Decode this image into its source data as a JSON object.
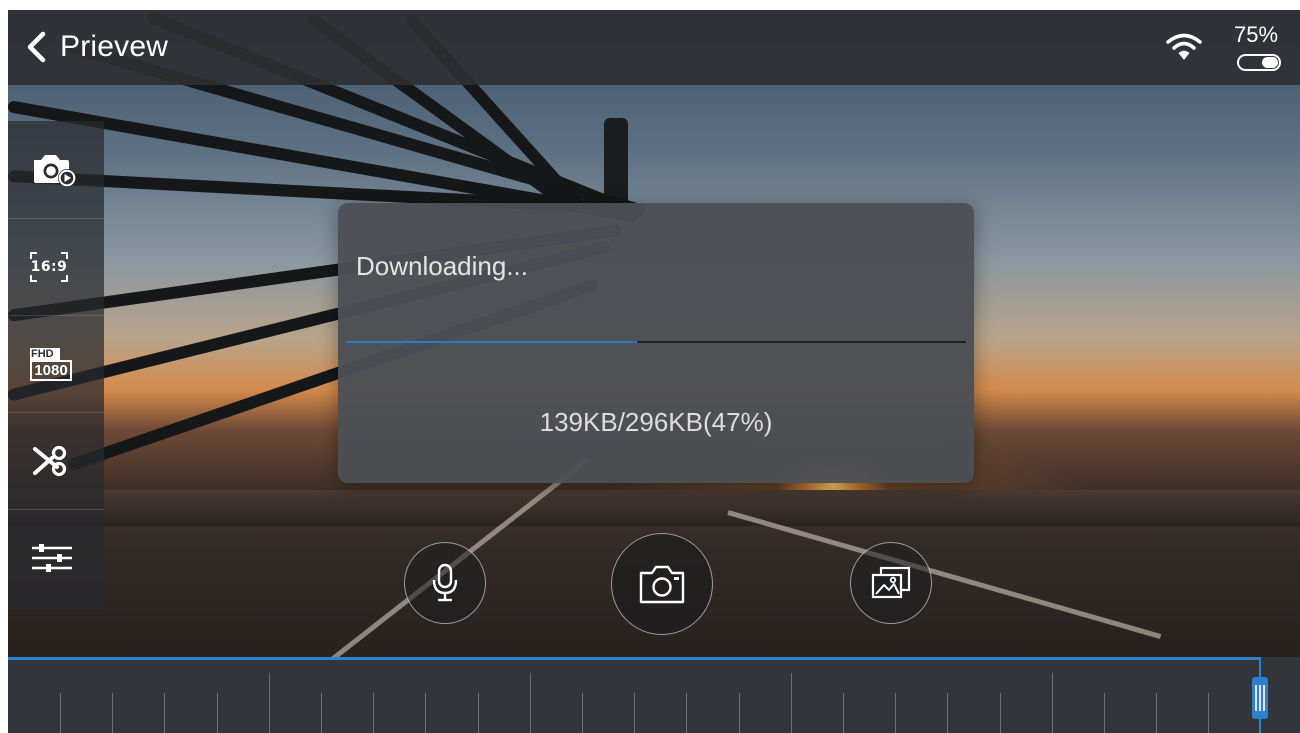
{
  "header": {
    "back_icon": "chevron-left-icon",
    "title": "Prievew",
    "wifi_icon": "wifi-icon",
    "battery_percent": "75%",
    "battery_level": 0.75
  },
  "sidebar": {
    "items": [
      {
        "name": "video-camera-playback",
        "icon": "camera-play-icon"
      },
      {
        "name": "aspect-ratio",
        "icon": "aspect-ratio-icon",
        "label": "16:9"
      },
      {
        "name": "resolution",
        "icon": "fhd-icon",
        "label_top": "FHD",
        "label_bottom": "1080"
      },
      {
        "name": "clip",
        "icon": "scissors-icon"
      },
      {
        "name": "settings",
        "icon": "sliders-icon"
      }
    ]
  },
  "dialog": {
    "title": "Downloading...",
    "status": "139KB/296KB(47%)",
    "progress": 0.47
  },
  "controls": {
    "mic_icon": "microphone-icon",
    "snapshot_icon": "camera-icon",
    "gallery_icon": "gallery-icon"
  },
  "timeline": {
    "scrub_position": 0.97
  },
  "colors": {
    "accent": "#2f7fcf",
    "bar": "#2d2f33",
    "dialog": "#4c4f54",
    "text": "#ffffff"
  }
}
